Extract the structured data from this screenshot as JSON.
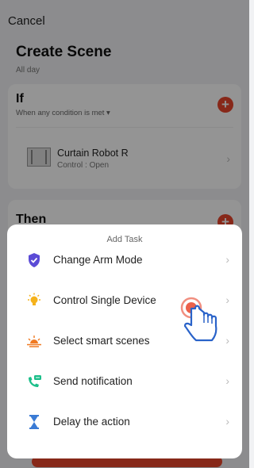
{
  "background": {
    "cancel": "Cancel",
    "title": "Create Scene",
    "subtitle": "All day",
    "if_section": {
      "title": "If",
      "condition": "When any condition is met ▾",
      "device_name": "Curtain Robot  R",
      "device_status": "Control : Open"
    },
    "then_section": {
      "title": "Then"
    }
  },
  "sheet": {
    "title": "Add Task",
    "items": [
      {
        "label": "Change Arm Mode",
        "icon": "shield-icon",
        "color": "#5b4bd6"
      },
      {
        "label": "Control Single Device",
        "icon": "bulb-icon",
        "color": "#f5b21b"
      },
      {
        "label": "Select smart scenes",
        "icon": "sunrise-icon",
        "color": "#f07a22"
      },
      {
        "label": "Send notification",
        "icon": "phone-message-icon",
        "color": "#1cbf8a"
      },
      {
        "label": "Delay the action",
        "icon": "hourglass-icon",
        "color": "#3a7bd5"
      }
    ]
  },
  "colors": {
    "accent": "#e8452c",
    "overlay": "rgba(0,0,0,0.42)"
  }
}
